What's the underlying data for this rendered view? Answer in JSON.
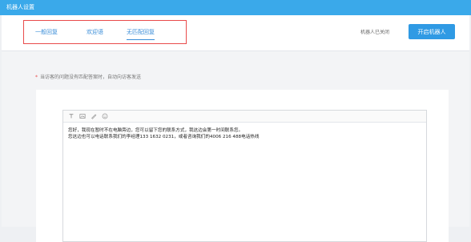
{
  "window": {
    "title": "机器人设置"
  },
  "tabs": [
    {
      "label": "一般回复",
      "active": false
    },
    {
      "label": "欢迎语",
      "active": false
    },
    {
      "label": "无匹配回复",
      "active": true
    }
  ],
  "robot_status": "机器人已关闭",
  "start_button": "开启机器人",
  "notice": {
    "marker": "*",
    "text": "当访客的问题没有匹配答案时，自动向访客发送"
  },
  "editor": {
    "toolbar_icons": [
      "text-icon",
      "image-icon",
      "pen-icon",
      "emoji-icon"
    ],
    "lines": [
      "您好，我现在暂时不在电脑旁边，您可以留下您的联系方式，我这边会第一时间联系您。",
      "您这边也可以电话联系我们的李经理133 1632 0231，或者咨询我们的4006 216 488电话热线"
    ]
  },
  "colors": {
    "titlebar": "#3aa9ea",
    "accent": "#3b8ed8",
    "button": "#2f9ae4",
    "highlight": "#e94b4b"
  }
}
